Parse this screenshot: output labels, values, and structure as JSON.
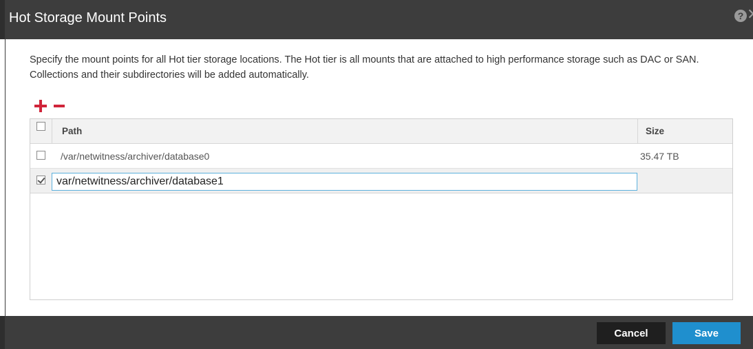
{
  "dialog": {
    "title": "Hot Storage Mount Points",
    "help_glyph": "?",
    "close_glyph": "✕"
  },
  "description": "Specify the mount points for all Hot tier storage locations. The Hot tier is all mounts that are attached to high performance storage such as DAC or SAN. Collections and their subdirectories will be added automatically.",
  "toolbar": {
    "add_icon": "plus-icon",
    "remove_icon": "minus-icon"
  },
  "table": {
    "columns": [
      "Path",
      "Size"
    ],
    "rows": [
      {
        "path": "/var/netwitness/archiver/database0",
        "size": "35.47 TB",
        "checked": false
      },
      {
        "path": "var/netwitness/archiver/database1",
        "size": "",
        "checked": true,
        "editing": true
      }
    ]
  },
  "footer": {
    "cancel_label": "Cancel",
    "save_label": "Save"
  },
  "colors": {
    "accent": "#1f8fce",
    "danger": "#d0253a",
    "chrome": "#3d3d3d"
  }
}
